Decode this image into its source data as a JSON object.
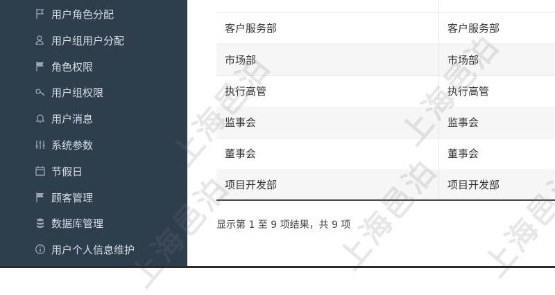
{
  "sidebar": {
    "items": [
      {
        "label": "用户角色分配",
        "icon": "flag-icon"
      },
      {
        "label": "用户组用户分配",
        "icon": "users-icon"
      },
      {
        "label": "角色权限",
        "icon": "flag-solid-icon"
      },
      {
        "label": "用户组权限",
        "icon": "key-icon"
      },
      {
        "label": "用户消息",
        "icon": "bell-icon"
      },
      {
        "label": "系统参数",
        "icon": "sliders-icon"
      },
      {
        "label": "节假日",
        "icon": "calendar-icon"
      },
      {
        "label": "顾客管理",
        "icon": "flag-solid-icon"
      },
      {
        "label": "数据库管理",
        "icon": "database-icon"
      },
      {
        "label": "用户个人信息维护",
        "icon": "info-icon"
      }
    ]
  },
  "table": {
    "rows": [
      {
        "col1": "客户服务部",
        "col2": "客户服务部"
      },
      {
        "col1": "市场部",
        "col2": "市场部"
      },
      {
        "col1": "执行高管",
        "col2": "执行高管"
      },
      {
        "col1": "监事会",
        "col2": "监事会"
      },
      {
        "col1": "董事会",
        "col2": "董事会"
      },
      {
        "col1": "项目开发部",
        "col2": "项目开发部"
      }
    ]
  },
  "pagination": {
    "summary": "显示第 1 至 9 项结果，共 9 项"
  },
  "watermark": {
    "text": "上海邑泊"
  },
  "colors": {
    "sidebar_bg": "#2f3e4d",
    "sidebar_text": "#d6dde5",
    "row_alt": "#f6f6f6"
  }
}
